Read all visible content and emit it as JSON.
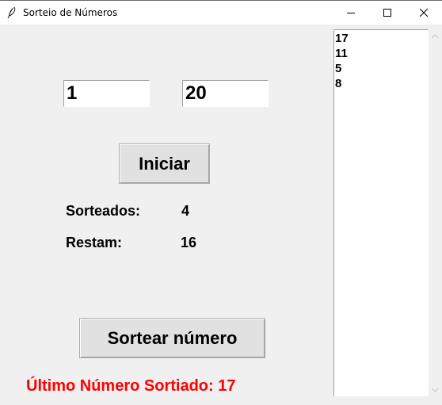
{
  "window": {
    "title": "Sorteio de Números",
    "icon": "feather-icon"
  },
  "inputs": {
    "min_value": "1",
    "max_value": "20"
  },
  "buttons": {
    "start_label": "Iniciar",
    "draw_label": "Sortear número"
  },
  "stats": {
    "drawn_label": "Sorteados:",
    "drawn_value": "4",
    "remaining_label": "Restam:",
    "remaining_value": "16"
  },
  "last_number": {
    "text": "Último Número Sortiado: 17",
    "color": "#ff0000"
  },
  "drawn_list": {
    "items": [
      "17",
      "11",
      "5",
      "8"
    ]
  }
}
